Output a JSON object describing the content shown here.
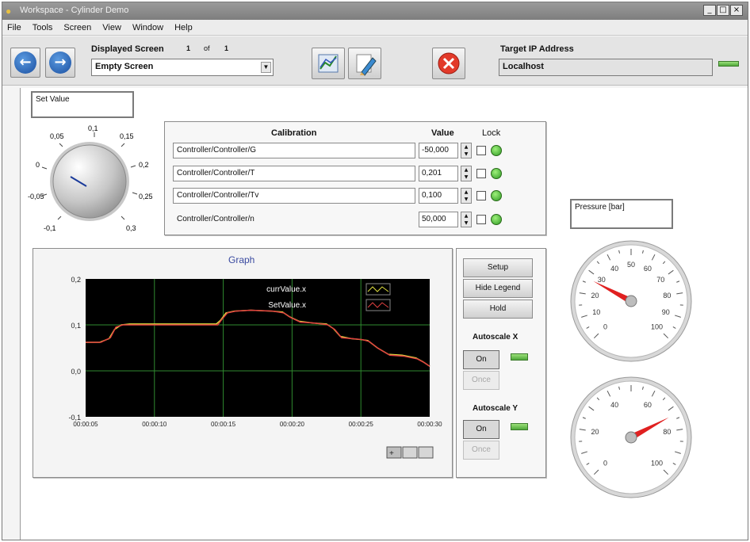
{
  "window": {
    "title": "Workspace - Cylinder Demo"
  },
  "menu": [
    "File",
    "Tools",
    "Screen",
    "View",
    "Window",
    "Help"
  ],
  "toolbar": {
    "displayed_screen_label": "Displayed Screen",
    "screen_index": "1",
    "of_label": "of",
    "screen_total": "1",
    "screen_value": "Empty Screen",
    "target_ip_label": "Target IP Address",
    "target_ip_value": "Localhost"
  },
  "set_value": {
    "label": "Set Value",
    "knob_ticks": [
      "0,05",
      "0,1",
      "0,15",
      "0,2",
      "0,25",
      "0,3",
      "-0,1",
      "-0,05",
      "0"
    ]
  },
  "calibration": {
    "header_name": "Calibration",
    "header_value": "Value",
    "header_lock": "Lock",
    "rows": [
      {
        "name": "Controller/Controller/G",
        "value": "-50,000"
      },
      {
        "name": "Controller/Controller/T",
        "value": "0,201"
      },
      {
        "name": "Controller/Controller/Tv",
        "value": "0,100"
      },
      {
        "name": "Controller/Controller/n",
        "value": "50,000"
      }
    ]
  },
  "graph": {
    "title": "Graph",
    "legend": [
      "currValue.x",
      "SetValue.x"
    ],
    "buttons": {
      "setup": "Setup",
      "legend": "Hide Legend",
      "hold": "Hold"
    },
    "autoscale_x": {
      "label": "Autoscale X",
      "on": "On",
      "once": "Once"
    },
    "autoscale_y": {
      "label": "Autoscale Y",
      "on": "On",
      "once": "Once"
    }
  },
  "chart_data": {
    "type": "line",
    "title": "Graph",
    "ylim": [
      -0.1,
      0.2
    ],
    "y_ticks": [
      "0,2",
      "0,1",
      "0,0",
      "-0,1"
    ],
    "x_ticks": [
      "00:00:05",
      "00:00:10",
      "00:00:15",
      "00:00:20",
      "00:00:25",
      "00:00:30"
    ],
    "grid": true,
    "legend_position": "top-right",
    "series": [
      {
        "name": "currValue.x",
        "color": "#e0e040",
        "x": [
          5,
          6,
          6.7,
          7.1,
          7.6,
          8.2,
          10,
          12,
          14.5,
          14.8,
          15.2,
          15.8,
          17,
          18.5,
          19.3,
          19.8,
          20.5,
          21.5,
          22.5,
          23,
          23.5,
          24.3,
          25,
          25.5,
          26.2,
          27,
          28,
          29,
          29.5,
          30
        ],
        "y": [
          0.062,
          0.062,
          0.07,
          0.09,
          0.1,
          0.102,
          0.102,
          0.102,
          0.102,
          0.11,
          0.126,
          0.13,
          0.132,
          0.13,
          0.128,
          0.118,
          0.108,
          0.104,
          0.102,
          0.092,
          0.075,
          0.07,
          0.068,
          0.066,
          0.05,
          0.036,
          0.034,
          0.028,
          0.02,
          0.01
        ]
      },
      {
        "name": "SetValue.x",
        "color": "#e04040",
        "x": [
          5,
          6.1,
          6.8,
          7.2,
          7.7,
          8.3,
          10,
          12,
          14.6,
          14.9,
          15.3,
          15.9,
          17,
          18.6,
          19.4,
          19.9,
          20.6,
          21.6,
          22.6,
          23.1,
          23.6,
          24.4,
          25.1,
          25.6,
          26.3,
          27.1,
          28.1,
          29.1,
          29.6,
          30
        ],
        "y": [
          0.062,
          0.062,
          0.072,
          0.095,
          0.1,
          0.1,
          0.1,
          0.1,
          0.1,
          0.112,
          0.126,
          0.13,
          0.132,
          0.13,
          0.126,
          0.116,
          0.106,
          0.104,
          0.1,
          0.09,
          0.072,
          0.07,
          0.068,
          0.064,
          0.048,
          0.034,
          0.032,
          0.026,
          0.018,
          0.01
        ]
      }
    ]
  },
  "pressure": {
    "label": "Pressure [bar]",
    "gauge_ticks": [
      "0",
      "10",
      "20",
      "30",
      "40",
      "50",
      "60",
      "70",
      "80",
      "90",
      "100"
    ],
    "gauge1_value": 27,
    "gauge2_value": 73,
    "gauge2_ticks": [
      "0",
      "20",
      "40",
      "60",
      "80",
      "100"
    ]
  },
  "colors": {
    "led_on": "#5fbf3f",
    "plot_bg": "#000000",
    "grid": "#2f8a2f",
    "needle": "#e02020"
  }
}
